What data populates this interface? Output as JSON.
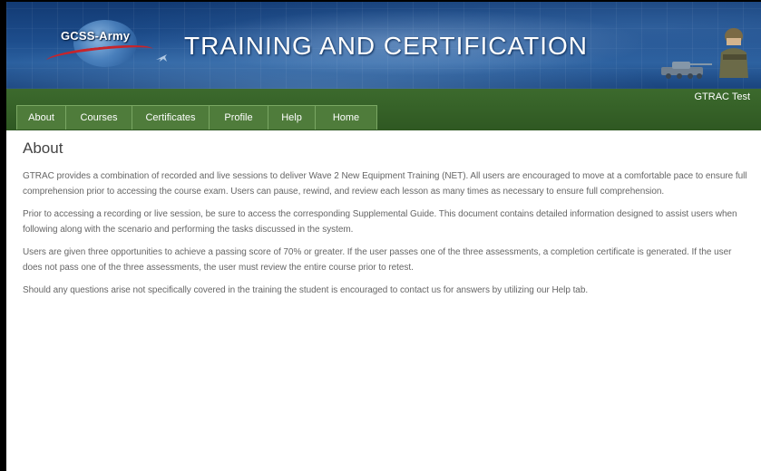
{
  "banner": {
    "logo_text": "GCSS-Army",
    "title": "TRAINING  AND CERTIFICATION"
  },
  "user": {
    "name": "GTRAC Test"
  },
  "nav": {
    "items": [
      {
        "label": "About"
      },
      {
        "label": "Courses"
      },
      {
        "label": "Certificates"
      },
      {
        "label": "Profile"
      },
      {
        "label": "Help"
      },
      {
        "label": "Home"
      }
    ]
  },
  "main": {
    "title": "About",
    "paragraphs": [
      "GTRAC provides a combination of recorded and live sessions to deliver Wave 2 New Equipment Training (NET). All users are encouraged to move at a comfortable pace to ensure full comprehension prior to accessing the course exam. Users can pause, rewind, and review each lesson as many times as necessary to ensure full comprehension.",
      "Prior to accessing a recording or live session, be sure to access the corresponding Supplemental Guide. This document contains detailed information designed to assist users when following along with the scenario and performing the tasks discussed in the system.",
      "Users are given three opportunities to achieve a passing score of 70% or greater. If the user passes one of the three assessments, a completion certificate is generated. If the user does not pass one of the three assessments, the user must review the entire course prior to retest.",
      "Should any questions arise not specifically covered in the training the student is encouraged to contact us for answers by utilizing our Help tab."
    ]
  },
  "colors": {
    "banner_blue": "#1d4d8c",
    "nav_green": "#3c6a2d",
    "tab_green": "#4f7c3b"
  }
}
